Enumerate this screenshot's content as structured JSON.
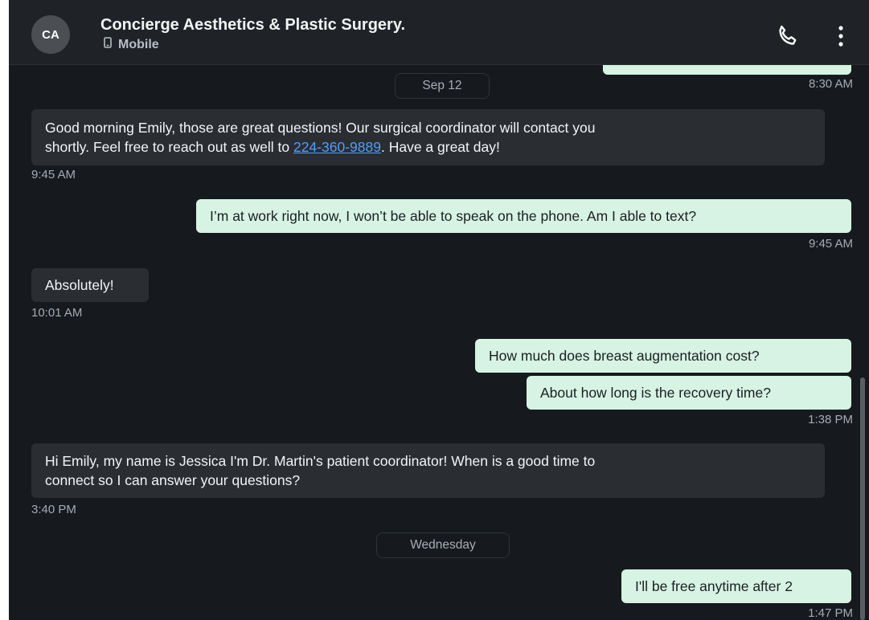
{
  "header": {
    "avatar_initials": "CA",
    "contact_name": "Concierge Aesthetics & Plastic Surgery.",
    "contact_type": "Mobile",
    "phone_icon": "phone-icon",
    "more_icon": "more-vertical-icon"
  },
  "messages": {
    "prev_time": "8:30 AM",
    "day1": "Sep 12",
    "m1_a": "Good morning Emily, those are great questions! Our surgical coordinator will contact you",
    "m1_b_pre": "shortly. Feel free to reach out as well to ",
    "m1_link": "224-360-9889",
    "m1_b_post": ". Have a great day!",
    "m1_time": "9:45 AM",
    "m2": "I’m at work right now, I won’t be able to speak on the phone. Am I able to text?",
    "m2_time": "9:45 AM",
    "m3": "Absolutely!",
    "m3_time": "10:01 AM",
    "m4": "How much does breast augmentation cost?",
    "m5": "About how long is the recovery time?",
    "m5_time": "1:38 PM",
    "m6_a": "Hi Emily, my name is Jessica I'm Dr. Martin's patient coordinator! When is a good time to",
    "m6_b": "connect so I can answer your questions?",
    "m6_time": "3:40 PM",
    "day2": "Wednesday",
    "m7": "I'll be free anytime after 2",
    "m7_time": "1:47 PM"
  },
  "colors": {
    "background": "#161a1e",
    "incoming_bubble": "#2a2e33",
    "outgoing_bubble": "#d7f3e3",
    "link": "#4f9dff"
  }
}
